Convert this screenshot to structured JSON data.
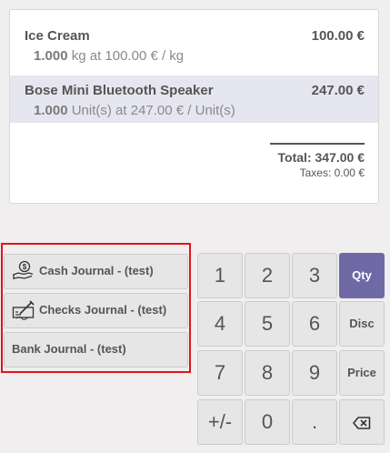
{
  "order": {
    "lines": [
      {
        "name": "Ice Cream",
        "price": "100.00 €",
        "quantity": "1.000",
        "unit_info": "kg at 100.00 € / kg",
        "selected": false
      },
      {
        "name": "Bose Mini Bluetooth Speaker",
        "price": "247.00 €",
        "quantity": "1.000",
        "unit_info": "Unit(s) at 247.00 € / Unit(s)",
        "selected": true
      }
    ],
    "total": "Total: 347.00 €",
    "taxes": "Taxes: 0.00 €"
  },
  "payment_methods": [
    {
      "label": "Cash Journal - (test)",
      "icon": "cash-icon"
    },
    {
      "label": "Checks Journal - (test)",
      "icon": "check-icon"
    },
    {
      "label": "Bank Journal - (test)",
      "icon": ""
    }
  ],
  "numpad": {
    "keys": [
      "1",
      "2",
      "3",
      "4",
      "5",
      "6",
      "7",
      "8",
      "9",
      "+/-",
      "0",
      "."
    ],
    "modes": [
      "Qty",
      "Disc",
      "Price"
    ],
    "active_mode": "Qty",
    "backspace_icon": "backspace-icon"
  },
  "colors": {
    "accent": "#6f6aa6",
    "selected_line": "#e6e6f0",
    "highlight_border": "#e0151c",
    "button": "#e6e6e6",
    "background": "#f0eeee"
  }
}
